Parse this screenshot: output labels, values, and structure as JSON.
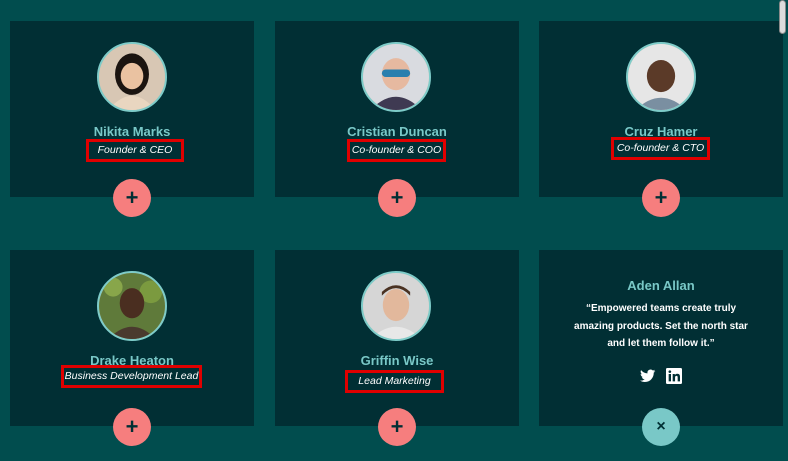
{
  "members": [
    {
      "name": "Nikita Marks",
      "role": "Founder & CEO"
    },
    {
      "name": "Cristian Duncan",
      "role": "Co-founder & COO"
    },
    {
      "name": "Cruz Hamer",
      "role": "Co-founder & CTO"
    },
    {
      "name": "Drake Heaton",
      "role": "Business Development Lead"
    },
    {
      "name": "Griffin Wise",
      "role": "Lead Marketing"
    }
  ],
  "featured": {
    "name": "Aden Allan",
    "quote": "“Empowered teams create truly amazing products. Set the north star and let them follow it.”",
    "social_icons": [
      "twitter-icon",
      "linkedin-icon"
    ]
  },
  "buttons": {
    "open_label": "+",
    "close_label": "×"
  },
  "colors": {
    "background": "#014D4E",
    "card": "#012F34",
    "accent_teal": "#79C8C7",
    "accent_coral": "#F67E7E",
    "highlight_box": "#E00000"
  }
}
